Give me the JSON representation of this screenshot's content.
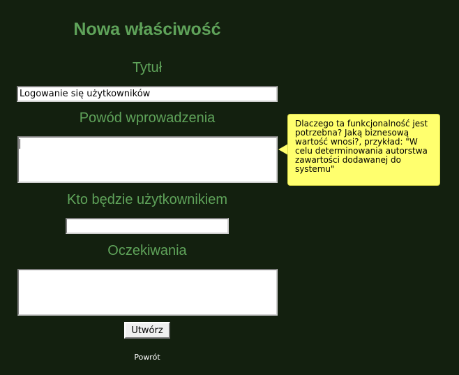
{
  "form": {
    "title": "Nowa właściwość",
    "fields": {
      "title_label": "Tytuł",
      "title_value": "Logowanie się użytkowników",
      "reason_label": "Powód wprowadzenia",
      "reason_value": "",
      "users_label": "Kto będzie użytkownikiem",
      "users_value": "",
      "expectations_label": "Oczekiwania",
      "expectations_value": ""
    },
    "tooltip": "Dlaczego ta funkcjonalność jest potrzebna? Jaką biznesową wartość wnosi?, przykład: \"W celu determinowania autorstwa zawartości dodawanej do systemu\"",
    "submit_label": "Utwórz",
    "back_label": "Powrót"
  },
  "colors": {
    "background": "#13200f",
    "heading": "#5fa35a",
    "tooltip_background": "#ffff6e"
  }
}
